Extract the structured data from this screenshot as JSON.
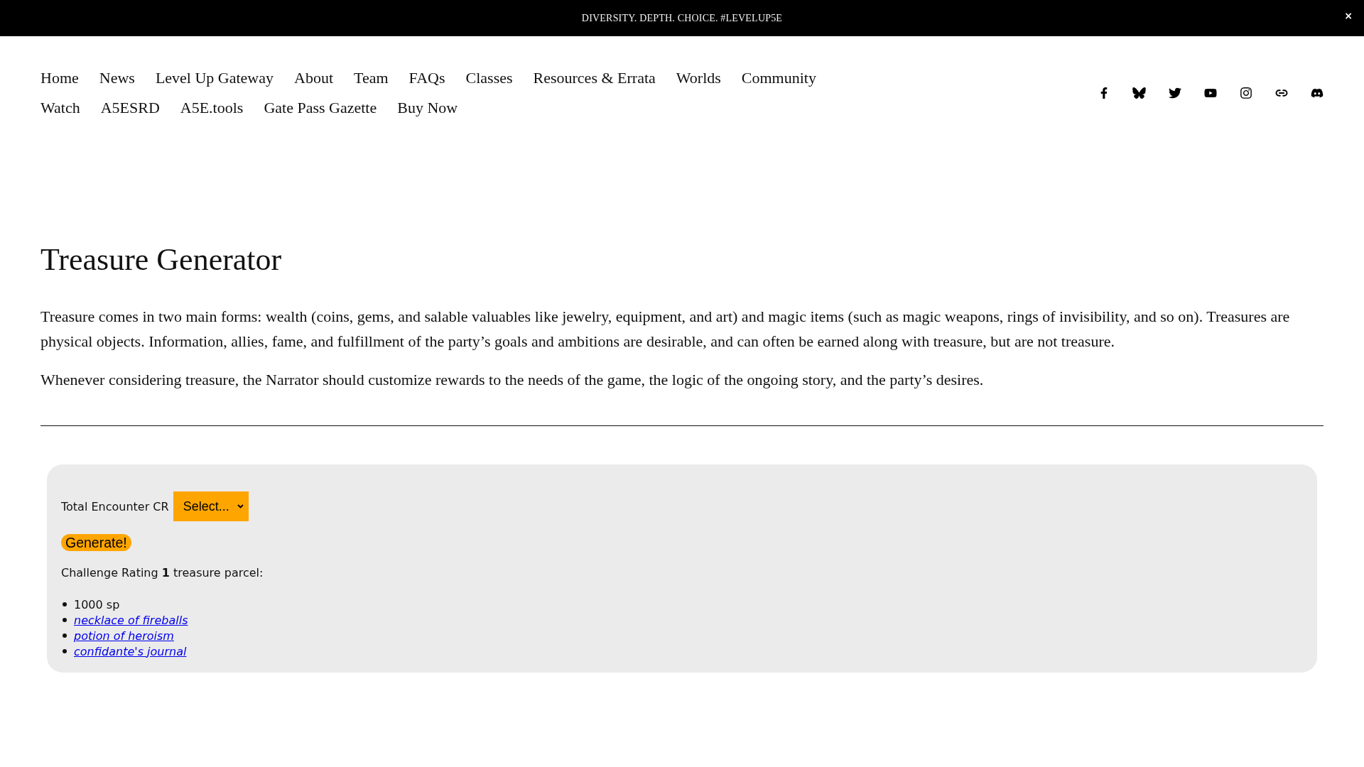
{
  "announcement_bar": {
    "text": "DIVERSITY. DEPTH. CHOICE. #LEVELUP5E",
    "close": "×"
  },
  "nav": {
    "items": [
      "Home",
      "News",
      "Level Up Gateway",
      "About",
      "Team",
      "FAQs",
      "Classes",
      "Resources & Errata",
      "Worlds",
      "Community",
      "Watch",
      "A5ESRD",
      "A5E.tools",
      "Gate Pass Gazette",
      "Buy Now"
    ]
  },
  "social_links": [
    {
      "kind": "facebook"
    },
    {
      "kind": "bluesky"
    },
    {
      "kind": "twitter"
    },
    {
      "kind": "youtube"
    },
    {
      "kind": "instagram"
    },
    {
      "kind": "link"
    },
    {
      "kind": "discord"
    }
  ],
  "page": {
    "title": "Treasure Generator",
    "paragraphs": [
      "Treasure comes in two main forms: wealth (coins, gems, and salable valuables like jewelry, equipment, and art) and magic items (such as magic weapons, rings of invisibility, and so on). Treasures are physical objects. Information, allies, fame, and fulfillment of the party’s goals and ambitions are desirable, and can often be earned along with treasure, but are not treasure.",
      "Whenever considering treasure, the Narrator should customize rewards to the needs of the game, the logic of the ongoing story, and the party’s desires."
    ]
  },
  "generator": {
    "cr_label": "Total Encounter CR",
    "cr_select": {
      "value": "Select..."
    },
    "generate_button": "Generate!",
    "result_heading": "Challenge Rating **1** treasure parcel:",
    "result_items": [
      {
        "kind": "text",
        "text": "1000 sp"
      },
      {
        "kind": "link",
        "text": "necklace of fireballs"
      },
      {
        "kind": "link",
        "text": "potion of heroism"
      },
      {
        "kind": "link",
        "text": "confidante's journal"
      }
    ]
  }
}
